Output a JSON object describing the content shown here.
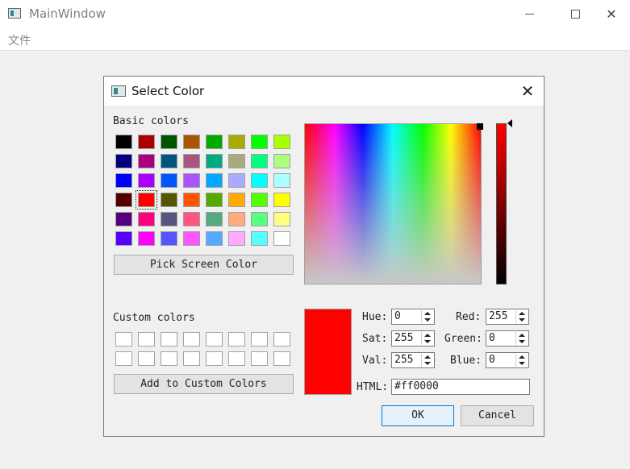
{
  "window": {
    "title": "MainWindow",
    "menu": [
      "文件"
    ]
  },
  "dialog": {
    "title": "Select Color",
    "basic_colors_label": "Basic colors",
    "custom_colors_label": "Custom colors",
    "pick_screen_label": "Pick Screen Color",
    "add_custom_label": "Add to Custom Colors",
    "basic_colors": [
      "#000000",
      "#aa0000",
      "#005500",
      "#aa5500",
      "#00aa00",
      "#aaaa00",
      "#00ff00",
      "#aaff00",
      "#00007f",
      "#aa007f",
      "#00557f",
      "#aa557f",
      "#00aa7f",
      "#aaaa7f",
      "#00ff7f",
      "#aaff7f",
      "#0000ff",
      "#aa00ff",
      "#0055ff",
      "#aa55ff",
      "#00aaff",
      "#aaaaff",
      "#00ffff",
      "#aaffff",
      "#550000",
      "#ff0000",
      "#555500",
      "#ff5500",
      "#55aa00",
      "#ffaa00",
      "#55ff00",
      "#ffff00",
      "#55007f",
      "#ff007f",
      "#55557f",
      "#ff557f",
      "#55aa7f",
      "#ffaa7f",
      "#55ff7f",
      "#ffff7f",
      "#5500ff",
      "#ff00ff",
      "#5555ff",
      "#ff55ff",
      "#55aaff",
      "#ffaaff",
      "#55ffff",
      "#ffffff"
    ],
    "selected_basic_index": 25,
    "custom_colors_count": 16,
    "fields": {
      "hue_label": "Hue:",
      "hue": "0",
      "sat_label": "Sat:",
      "sat": "255",
      "val_label": "Val:",
      "val": "255",
      "red_label": "Red:",
      "red": "255",
      "green_label": "Green:",
      "green": "0",
      "blue_label": "Blue:",
      "blue": "0",
      "html_label": "HTML:",
      "html": "#ff0000"
    },
    "current_color": "#ff0000",
    "ok_label": "OK",
    "cancel_label": "Cancel"
  }
}
